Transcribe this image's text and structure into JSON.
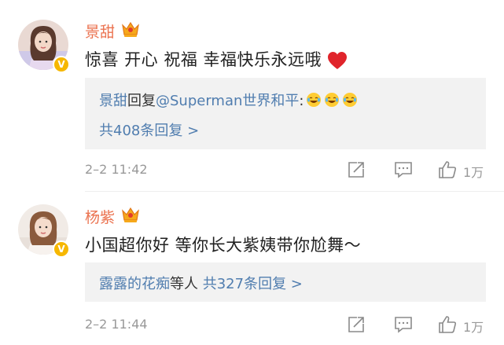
{
  "comments": [
    {
      "username": "景甜",
      "avatar_icon": "avatar-photo",
      "verified_icon": "verified-v-icon",
      "member_icon": "vip-crown-icon",
      "content": "惊喜 开心 祝福 幸福快乐永远哦",
      "content_emoji": "heart-icon",
      "reply": {
        "replier": "景甜",
        "reply_word": "回复",
        "target": "@Superman世界和平",
        "colon": ":",
        "emojis": [
          "laugh-cry-icon",
          "laugh-cry-icon",
          "laugh-cry-icon"
        ],
        "more_label": "共408条回复 >"
      },
      "time": "2–2 11:42",
      "like_count": "1万"
    },
    {
      "username": "杨紫",
      "avatar_icon": "avatar-photo",
      "verified_icon": "verified-v-icon",
      "member_icon": "vip-crown-icon",
      "content": "小国超你好 等你长大紫姨带你尬舞～",
      "reply": {
        "repliers": "露露的花痴",
        "others": "等人",
        "more_label": "共327条回复 >"
      },
      "time": "2–2 11:44",
      "like_count": "1万"
    }
  ],
  "colors": {
    "username": "#eb7350",
    "link": "#507daf",
    "meta": "#999999",
    "reply_bg": "#f2f2f2",
    "badge": "#f6b700",
    "heart": "#e0242b"
  }
}
